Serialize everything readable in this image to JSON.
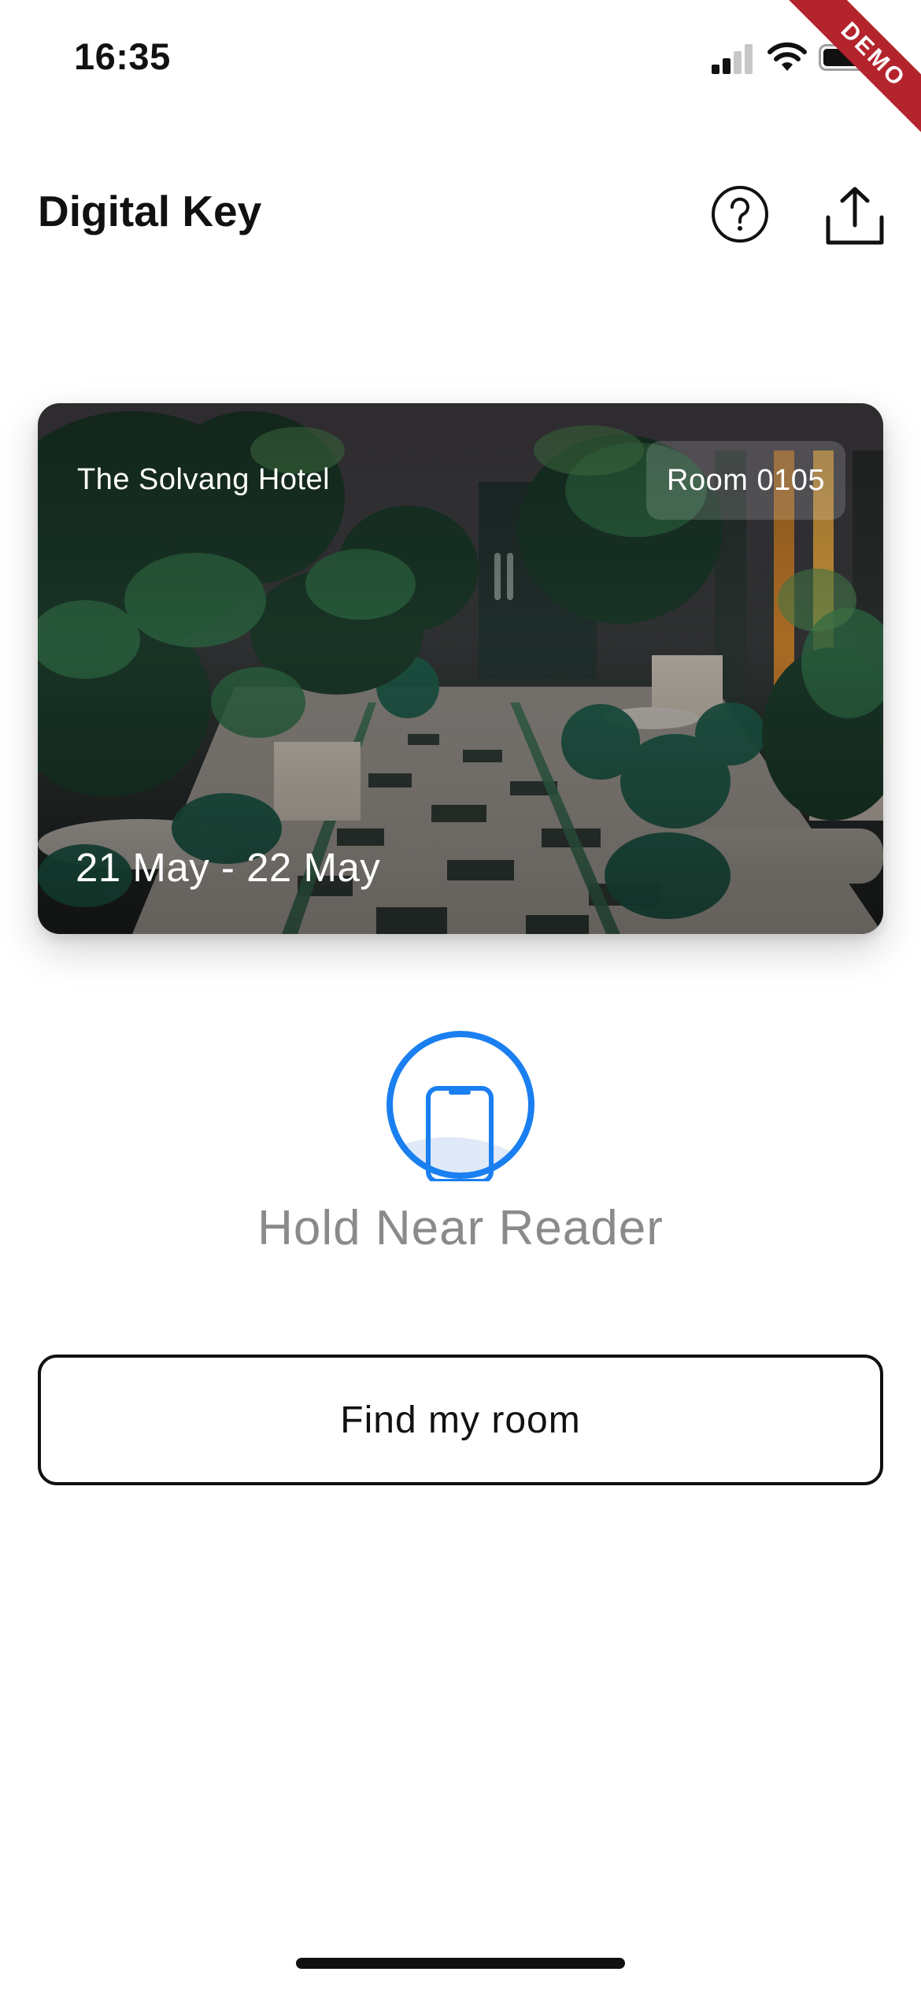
{
  "status_bar": {
    "time": "16:35",
    "signal_icon": "cellular-signal-icon",
    "wifi_icon": "wifi-icon",
    "battery_icon": "battery-icon"
  },
  "demo_ribbon": {
    "label": "DEMO",
    "color": "#b3242d"
  },
  "header": {
    "title": "Digital Key",
    "help_icon": "help-circle-icon",
    "share_icon": "share-upload-icon"
  },
  "card": {
    "hotel_name": "The Solvang Hotel",
    "room": "Room 0105",
    "dates": "21 May - 22 May"
  },
  "nfc": {
    "icon": "phone-nfc-icon",
    "accent_color": "#1a7ff0",
    "label": "Hold Near Reader"
  },
  "actions": {
    "find_room_label": "Find my room"
  }
}
